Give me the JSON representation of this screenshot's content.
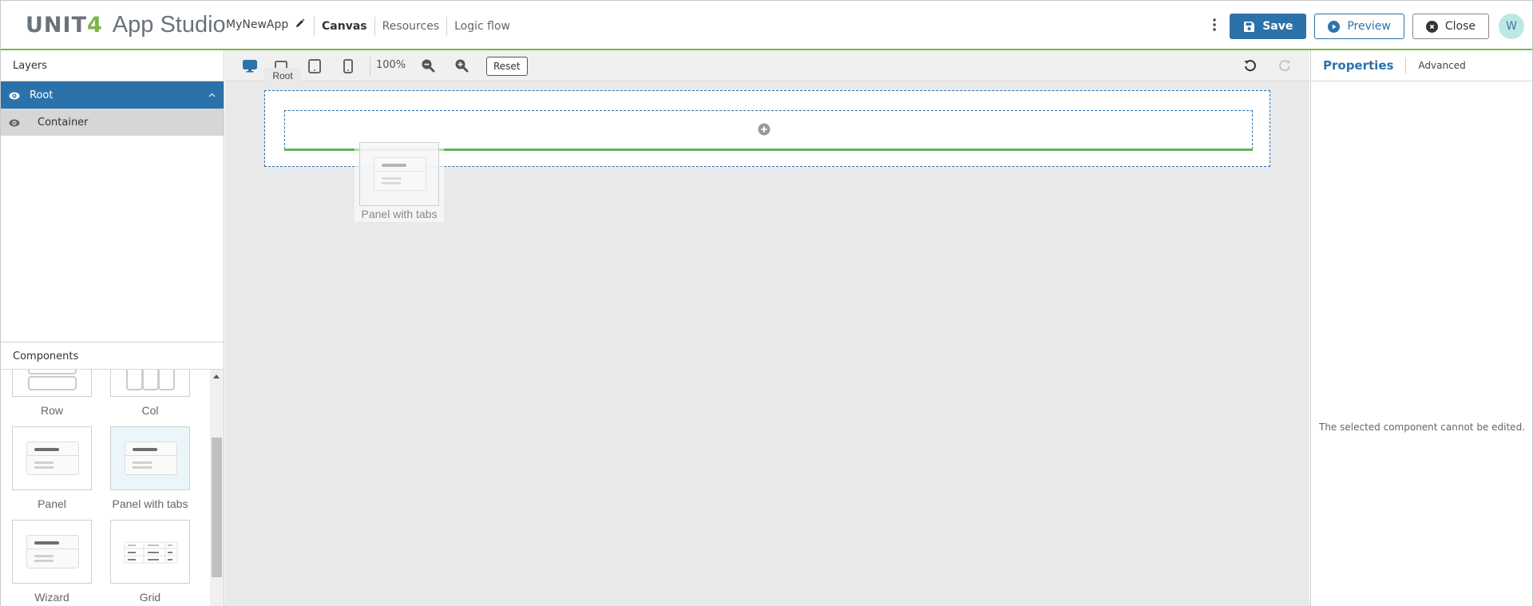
{
  "header": {
    "logo_mark": "UNIT",
    "logo_mark_digit": "4",
    "logo_app": "App Studio",
    "app_name": "MyNewApp",
    "nav": [
      "Canvas",
      "Resources",
      "Logic flow"
    ],
    "active_nav": "Canvas",
    "save_label": "Save",
    "preview_label": "Preview",
    "close_label": "Close",
    "avatar_initial": "W"
  },
  "layers": {
    "title": "Layers",
    "items": [
      {
        "label": "Root",
        "selected": true,
        "expanded": true
      },
      {
        "label": "Container",
        "selected": false
      }
    ]
  },
  "components": {
    "title": "Components",
    "items": [
      {
        "label": "Row"
      },
      {
        "label": "Col"
      },
      {
        "label": "Panel"
      },
      {
        "label": "Panel with tabs",
        "highlighted": true
      },
      {
        "label": "Wizard"
      },
      {
        "label": "Grid"
      }
    ]
  },
  "toolbar": {
    "devices": [
      "desktop-icon",
      "laptop-icon",
      "tablet-icon",
      "phone-icon"
    ],
    "active_device": "desktop",
    "zoom": "100%",
    "reset_label": "Reset",
    "tooltip": "Root"
  },
  "canvas": {
    "drag_ghost_label": "Panel with tabs"
  },
  "properties": {
    "tabs": [
      "Properties",
      "Advanced"
    ],
    "active_tab": "Properties",
    "message": "The selected component cannot be edited."
  },
  "colors": {
    "brand_green": "#7ab648",
    "primary_blue": "#2b72ab",
    "drop_indicator": "#5cb85c"
  }
}
